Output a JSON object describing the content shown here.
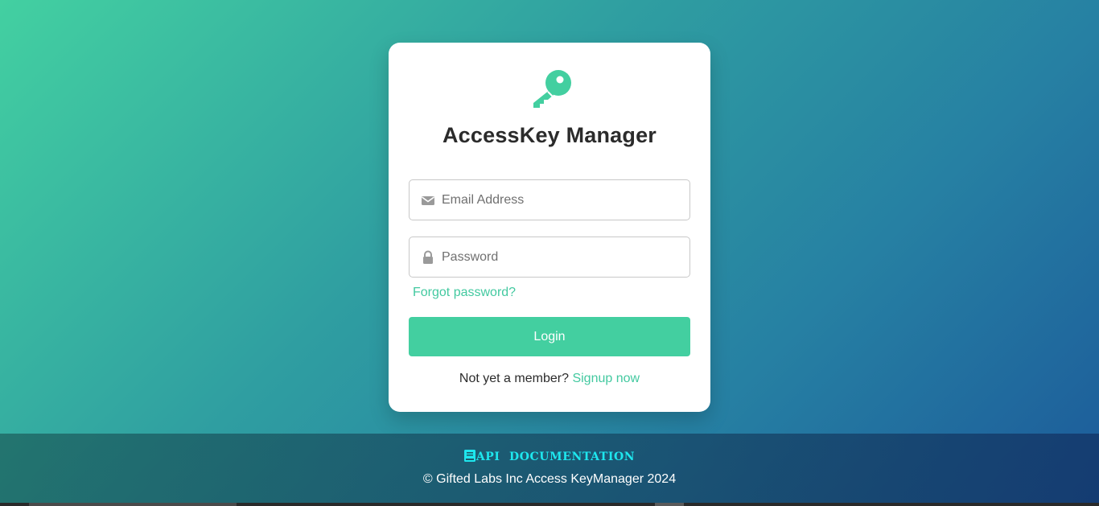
{
  "app": {
    "title": "AccessKey Manager"
  },
  "login_form": {
    "email": {
      "placeholder": "Email Address",
      "value": "",
      "icon": "envelope-icon"
    },
    "password": {
      "placeholder": "Password",
      "value": "",
      "icon": "lock-icon"
    },
    "forgot_password_label": "Forgot password?",
    "login_button_label": "Login",
    "signup_prompt": "Not yet a member?",
    "signup_link_label": "Signup now"
  },
  "footer": {
    "api_doc_label": "API DOCUMENTATION",
    "api_doc_icon": "book-icon",
    "copyright": "© Gifted Labs Inc Access KeyManager 2024"
  },
  "colors": {
    "accent": "#43cfa0",
    "link": "#43c9a0",
    "api_link": "#1ee6ee",
    "title_text": "#2b2b2b"
  },
  "logo_icon": "key-icon"
}
